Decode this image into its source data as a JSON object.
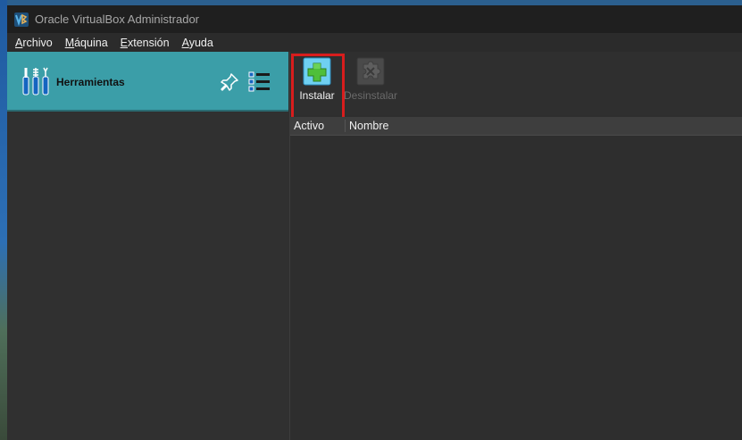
{
  "window": {
    "title": "Oracle VirtualBox Administrador",
    "logo_icon": "virtualbox-logo-icon"
  },
  "menubar": {
    "items": [
      {
        "underlined": "A",
        "rest": "rchivo"
      },
      {
        "underlined": "M",
        "rest": "áquina"
      },
      {
        "underlined": "E",
        "rest": "xtensión"
      },
      {
        "underlined": "A",
        "rest": "yuda"
      }
    ]
  },
  "sidebar": {
    "tools_label": "Herramientas",
    "tools_icon": "tools-icon",
    "pin_icon": "pin-icon",
    "menu_icon": "list-menu-icon",
    "accent_color": "#3b9ea8"
  },
  "toolbar": {
    "install_label": "Instalar",
    "install_icon": "install-plus-icon",
    "uninstall_label": "Desinstalar",
    "uninstall_icon": "uninstall-puzzle-icon",
    "uninstall_enabled": false,
    "highlight_color": "#d81d1d"
  },
  "table": {
    "columns": [
      "Activo",
      "Nombre"
    ],
    "rows": []
  }
}
